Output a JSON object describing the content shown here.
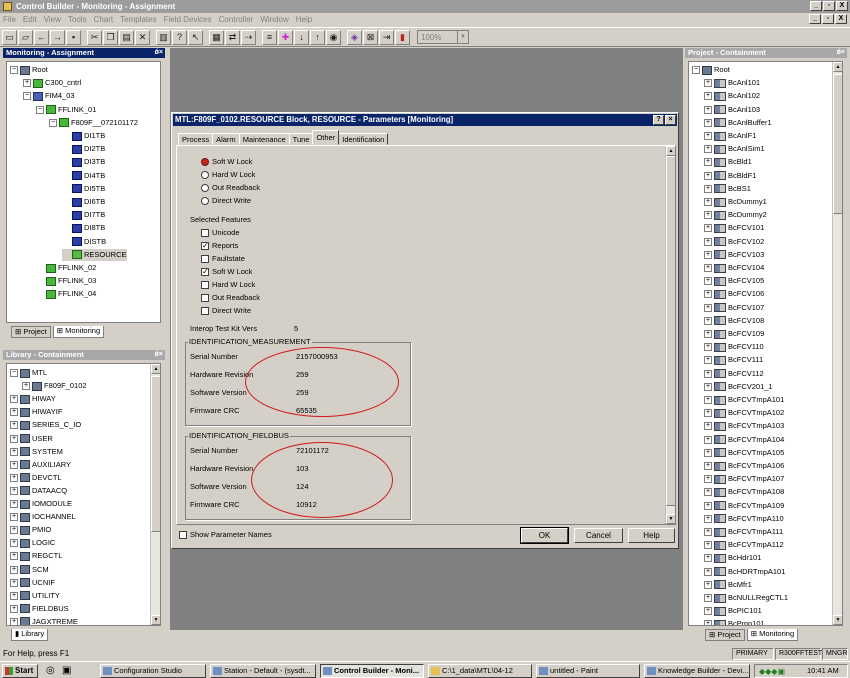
{
  "window": {
    "title": "Control Builder - Monitoring - Assignment",
    "controls": [
      "_",
      "▫",
      "X"
    ]
  },
  "menu": [
    "File",
    "Edit",
    "View",
    "Tools",
    "Chart",
    "Templates",
    "Field Devices",
    "Controller",
    "Window",
    "Help"
  ],
  "mdi_controls": [
    "_",
    "▫",
    "X"
  ],
  "toolbar": {
    "zoom": "100%"
  },
  "left_top_panel": {
    "title": "Monitoring - Assignment",
    "tree": [
      {
        "label": "Root",
        "depth": 0,
        "exp": "−",
        "icon": "lib"
      },
      {
        "label": "C300_cntrl",
        "depth": 1,
        "exp": "+",
        "icon": "green"
      },
      {
        "label": "FIM4_03",
        "depth": 1,
        "exp": "−",
        "icon": "ctrl"
      },
      {
        "label": "FFLINK_01",
        "depth": 2,
        "exp": "−",
        "icon": "green"
      },
      {
        "label": "F809F__072101172",
        "depth": 3,
        "exp": "−",
        "icon": "green"
      },
      {
        "label": "DI1TB",
        "depth": 4,
        "exp": "",
        "icon": "chip"
      },
      {
        "label": "DI2TB",
        "depth": 4,
        "exp": "",
        "icon": "chip"
      },
      {
        "label": "DI3TB",
        "depth": 4,
        "exp": "",
        "icon": "chip"
      },
      {
        "label": "DI4TB",
        "depth": 4,
        "exp": "",
        "icon": "chip"
      },
      {
        "label": "DI5TB",
        "depth": 4,
        "exp": "",
        "icon": "chip"
      },
      {
        "label": "DI6TB",
        "depth": 4,
        "exp": "",
        "icon": "chip"
      },
      {
        "label": "DI7TB",
        "depth": 4,
        "exp": "",
        "icon": "chip"
      },
      {
        "label": "DI8TB",
        "depth": 4,
        "exp": "",
        "icon": "chip"
      },
      {
        "label": "DISTB",
        "depth": 4,
        "exp": "",
        "icon": "chip"
      },
      {
        "label": "RESOURCE",
        "depth": 4,
        "exp": "",
        "icon": "res",
        "selected": true
      },
      {
        "label": "FFLINK_02",
        "depth": 2,
        "exp": "",
        "icon": "green"
      },
      {
        "label": "FFLINK_03",
        "depth": 2,
        "exp": "",
        "icon": "green"
      },
      {
        "label": "FFLINK_04",
        "depth": 2,
        "exp": "",
        "icon": "green"
      }
    ],
    "tabs": [
      "Project",
      "Monitoring"
    ]
  },
  "left_bottom_panel": {
    "title": "Library - Containment",
    "tree": [
      {
        "label": "MTL",
        "depth": 0,
        "exp": "−"
      },
      {
        "label": "F809F_0102",
        "depth": 1,
        "exp": "+"
      },
      {
        "label": "HIWAY",
        "depth": 0,
        "exp": "+"
      },
      {
        "label": "HIWAYIF",
        "depth": 0,
        "exp": "+"
      },
      {
        "label": "SERIES_C_IO",
        "depth": 0,
        "exp": "+"
      },
      {
        "label": "USER",
        "depth": 0,
        "exp": "+"
      },
      {
        "label": "SYSTEM",
        "depth": 0,
        "exp": "+"
      },
      {
        "label": "AUXILIARY",
        "depth": 0,
        "exp": "+"
      },
      {
        "label": "DEVCTL",
        "depth": 0,
        "exp": "+"
      },
      {
        "label": "DATAACQ",
        "depth": 0,
        "exp": "+"
      },
      {
        "label": "IOMODULE",
        "depth": 0,
        "exp": "+"
      },
      {
        "label": "IOCHANNEL",
        "depth": 0,
        "exp": "+"
      },
      {
        "label": "PMIO",
        "depth": 0,
        "exp": "+"
      },
      {
        "label": "LOGIC",
        "depth": 0,
        "exp": "+"
      },
      {
        "label": "REGCTL",
        "depth": 0,
        "exp": "+"
      },
      {
        "label": "SCM",
        "depth": 0,
        "exp": "+"
      },
      {
        "label": "UCNIF",
        "depth": 0,
        "exp": "+"
      },
      {
        "label": "UTILITY",
        "depth": 0,
        "exp": "+"
      },
      {
        "label": "FIELDBUS",
        "depth": 0,
        "exp": "+"
      },
      {
        "label": "JAGXTREME",
        "depth": 0,
        "exp": "+"
      }
    ],
    "tabs": [
      "Library"
    ]
  },
  "right_panel": {
    "title": "Project - Containment",
    "root": "Root",
    "items": [
      "BcAnl101",
      "BcAnl102",
      "BcAnl103",
      "BcAnlBuffer1",
      "BcAnlF1",
      "BcAnlSim1",
      "BcBld1",
      "BcBldF1",
      "BcBS1",
      "BcDummy1",
      "BcDummy2",
      "BcFCV101",
      "BcFCV102",
      "BcFCV103",
      "BcFCV104",
      "BcFCV105",
      "BcFCV106",
      "BcFCV107",
      "BcFCV108",
      "BcFCV109",
      "BcFCV110",
      "BcFCV111",
      "BcFCV112",
      "BcFCV201_1",
      "BcFCVTmpA101",
      "BcFCVTmpA102",
      "BcFCVTmpA103",
      "BcFCVTmpA104",
      "BcFCVTmpA105",
      "BcFCVTmpA106",
      "BcFCVTmpA107",
      "BcFCVTmpA108",
      "BcFCVTmpA109",
      "BcFCVTmpA110",
      "BcFCVTmpA111",
      "BcFCVTmpA112",
      "BcHdr101",
      "BcHDRTmpA101",
      "BcMfr1",
      "BcNULLRegCTL1",
      "BcPIC101",
      "BcPmp101"
    ],
    "tabs": [
      "Project",
      "Monitoring"
    ]
  },
  "dialog": {
    "title": "MTL:F809F_0102.RESOURCE Block, RESOURCE - Parameters [Monitoring]",
    "tabs": [
      "Process",
      "Alarm",
      "Maintenance",
      "Tune",
      "Other",
      "Identification"
    ],
    "active_tab": "Other",
    "radios": [
      {
        "label": "Soft W Lock",
        "on": true
      },
      {
        "label": "Hard W Lock",
        "on": false
      },
      {
        "label": "Out Readback",
        "on": false
      },
      {
        "label": "Direct Write",
        "on": false
      }
    ],
    "features_label": "Selected Features",
    "features": [
      {
        "label": "Unicode",
        "checked": false
      },
      {
        "label": "Reports",
        "checked": true
      },
      {
        "label": "Faultstate",
        "checked": false
      },
      {
        "label": "Soft W Lock",
        "checked": true
      },
      {
        "label": "Hard W Lock",
        "checked": false
      },
      {
        "label": "Out Readback",
        "checked": false
      },
      {
        "label": "Direct Write",
        "checked": false
      }
    ],
    "interop_label": "Interop Test Kit Vers",
    "interop_value": "5",
    "measurement": {
      "title": "IDENTIFICATION_MEASUREMENT",
      "rows": [
        {
          "label": "Serial Number",
          "value": "2157000953"
        },
        {
          "label": "Hardware Revision",
          "value": "259"
        },
        {
          "label": "Software Version",
          "value": "259"
        },
        {
          "label": "Firmware CRC",
          "value": "65535"
        }
      ]
    },
    "fieldbus": {
      "title": "IDENTIFICATION_FIELDBUS",
      "rows": [
        {
          "label": "Serial Number",
          "value": "72101172"
        },
        {
          "label": "Hardware Revision",
          "value": "103"
        },
        {
          "label": "Software Version",
          "value": "124"
        },
        {
          "label": "Firmware CRC",
          "value": "10912"
        }
      ]
    },
    "show_names": "Show Parameter Names",
    "ok": "OK",
    "cancel": "Cancel",
    "help": "Help"
  },
  "status": {
    "text": "For Help, press F1",
    "panes": [
      "PRIMARY",
      "R300FFTEST",
      "MNGR"
    ]
  },
  "taskbar": {
    "start": "Start",
    "tasks": [
      "Configuration Studio",
      "Station - Default - (sysdt...",
      "Control Builder - Moni...",
      "C:\\1_data\\MTL\\04-12",
      "untitled - Paint",
      "Knowledge Builder - Devi..."
    ],
    "clock": "10:41 AM"
  }
}
